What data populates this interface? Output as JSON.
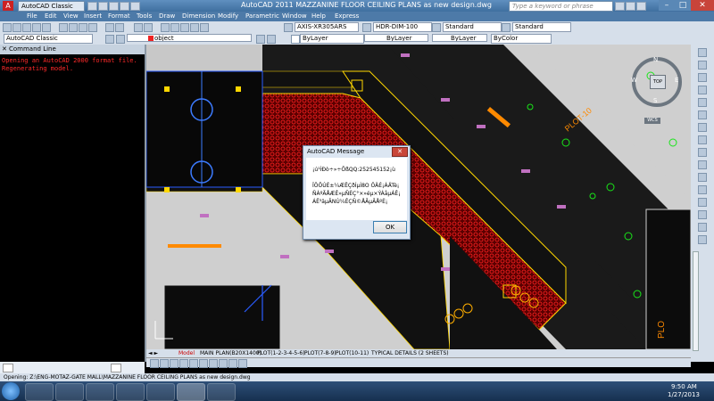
{
  "window": {
    "title": "AutoCAD 2011    MAZZANINE FLOOR CEILING PLANS as new design.dwg",
    "workspace": "AutoCAD Classic",
    "search_placeholder": "Type a keyword or phrase",
    "accent": "#4d7aa8"
  },
  "menu": [
    "File",
    "Edit",
    "View",
    "Insert",
    "Format",
    "Tools",
    "Draw",
    "Dimension",
    "Modify",
    "Parametric",
    "Window",
    "Help",
    "Express"
  ],
  "toolbar1": {
    "textstyle": "AXIS-XR305ARS",
    "dimstyle": "HDR-DIM-100",
    "tablestyle": "Standard",
    "mleaderstyle": "Standard"
  },
  "toolbar2": {
    "workspace": "AutoCAD Classic",
    "layer": "object",
    "color": "ByLayer",
    "linetype": "ByLayer",
    "lineweight": "ByLayer",
    "plotstyle": "ByColor"
  },
  "command_panel": {
    "header": "Command Line",
    "lines": "Opening an AutoCAD 2000 format file.\nRegenerating model."
  },
  "dialog": {
    "title": "AutoCAD Message",
    "line1": "¡ú¹ÌÐò÷»÷ÕßQQ:252545152¡ù",
    "line2": "ÏÖÔÚÉ±¼ÆËÇðÍµÌ8O ÖÄÉ¡ÁÄTè¡",
    "line3": "ÑÁºÃÅÆÊ»µÑÈÇ°×»éµ×ÝÁåµÁÊ¡",
    "line4": "ÁÊ³äµÃNÙ¼ÊÇÑ©ÅÃµÃÅºÈ¡",
    "ok_label": "OK"
  },
  "drawing_labels": {
    "plot": "PLOT-10",
    "plot2": "PLO",
    "top": "TOP",
    "north": "N",
    "south": "S",
    "east": "E",
    "west": "W",
    "wcs": "WCS"
  },
  "tabs": [
    "Model",
    "MAIN PLAN(B20X1400)",
    "PLOT(1-2-3-4-5-6)",
    "PLOT(7-8-9)",
    "PLOT(10-11)",
    "TYPICAL DETAILS (2 SHEETS)"
  ],
  "statusbar": "Opening: Z:\\ENG-MOTAZ-GATE MALL\\MAZZANINE FLOOR CEILING PLANS as new design.dwg",
  "clock": {
    "time": "9:50 AM",
    "date": "1/27/2013"
  }
}
